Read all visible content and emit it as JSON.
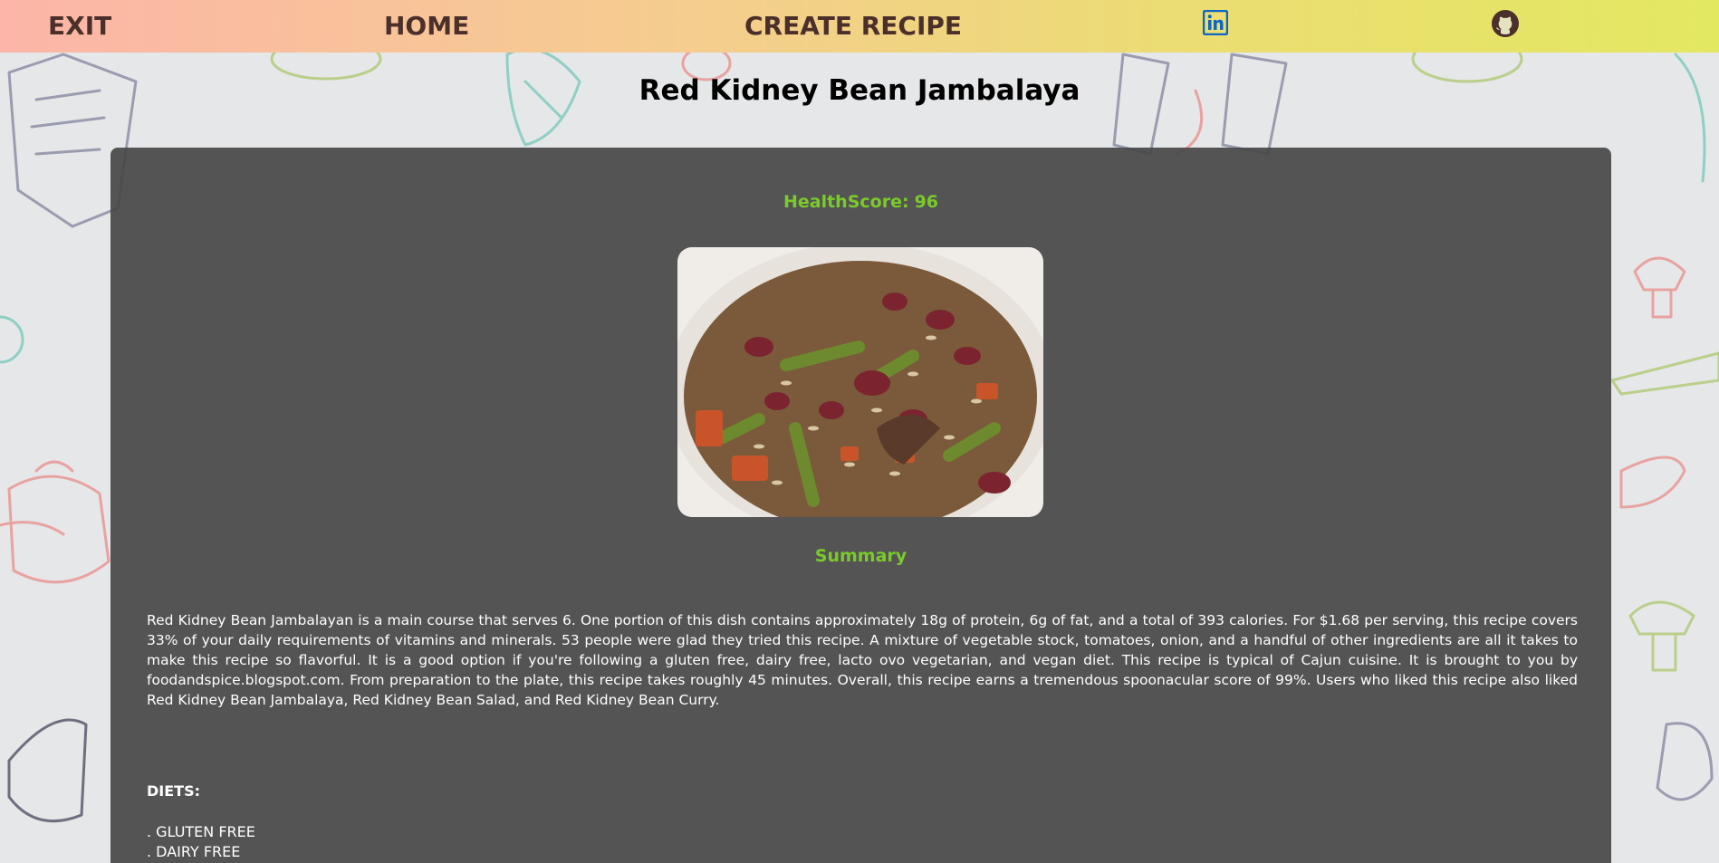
{
  "nav": {
    "exit_label": "EXIT",
    "home_label": "HOME",
    "create_label": "CREATE RECIPE",
    "linkedin_icon": "linkedin-icon",
    "github_icon": "github-icon"
  },
  "recipe": {
    "title": "Red Kidney Bean Jambalaya",
    "health_score_label": "HealthScore:",
    "health_score_value": "96",
    "image_subject": "red kidney bean jambalaya dish",
    "summary_heading": "Summary",
    "summary": "Red Kidney Bean Jambalayan is a main course that serves 6. One portion of this dish contains approximately 18g of protein, 6g of fat, and a total of 393 calories. For $1.68 per serving, this recipe covers 33% of your daily requirements of vitamins and minerals. 53 people were glad they tried this recipe. A mixture of vegetable stock, tomatoes, onion, and a handful of other ingredients are all it takes to make this recipe so flavorful. It is a good option if you're following a gluten free, dairy free, lacto ovo vegetarian, and vegan diet. This recipe is typical of Cajun cuisine. It is brought to you by foodandspice.blogspot.com. From preparation to the plate, this recipe takes roughly 45 minutes. Overall, this recipe earns a tremendous spoonacular score of 99%. Users who liked this recipe also liked Red Kidney Bean Jambalaya, Red Kidney Bean Salad, and Red Kidney Bean Curry.",
    "diets_heading": "DIETS:",
    "diets": [
      "GLUTEN FREE",
      "DAIRY FREE"
    ]
  },
  "colors": {
    "nav_gradient_start": "#fcb5a8",
    "nav_gradient_end": "#e3e861",
    "nav_text": "#4b2f2a",
    "accent_green": "#7acb2a",
    "card_bg": "#484848",
    "linkedin_blue": "#0a66c2"
  }
}
